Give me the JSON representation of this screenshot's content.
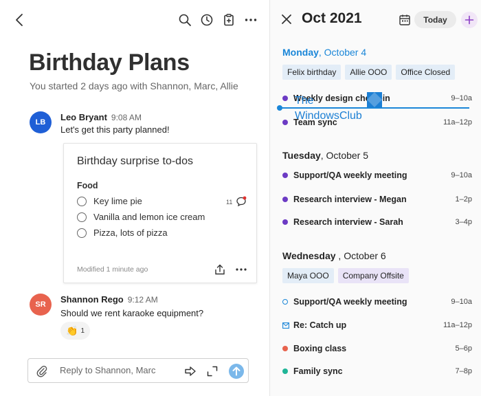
{
  "conversation": {
    "title": "Birthday Plans",
    "subtitle": "You started 2 days ago with Shannon, Marc, Allie",
    "messages": [
      {
        "initials": "LB",
        "name": "Leo Bryant",
        "time": "9:08 AM",
        "text": "Let's get this party planned!",
        "avatar_color": "#1f5fd6"
      },
      {
        "initials": "SR",
        "name": "Shannon Rego",
        "time": "9:12 AM",
        "text": "Should we rent karaoke equipment?",
        "avatar_color": "#e8634e"
      }
    ],
    "card": {
      "title": "Birthday surprise to-dos",
      "section": "Food",
      "todos": [
        "Key lime pie",
        "Vanilla and lemon ice cream",
        "Pizza, lots of pizza"
      ],
      "comment_count": "11",
      "modified": "Modified 1 minute ago"
    },
    "reaction": {
      "emoji": "👏",
      "count": "1"
    },
    "reply_placeholder": "Reply to Shannon, Marc"
  },
  "calendar": {
    "month": "Oct 2021",
    "today_label": "Today",
    "accent": "#1a86d8",
    "days": [
      {
        "name": "Monday",
        "date": ", October 4",
        "chips": [
          "Felix birthday",
          "Allie OOO",
          "Office Closed"
        ],
        "events": [
          {
            "title": "Weekly design check-in",
            "time": "9–10a",
            "color": "#6c3bc4"
          },
          {
            "title": "Team sync",
            "time": "11a–12p",
            "color": "#6c3bc4"
          }
        ]
      },
      {
        "name": "Tuesday",
        "date": ", October 5",
        "chips": [],
        "events": [
          {
            "title": "Support/QA weekly meeting",
            "time": "9–10a",
            "color": "#6c3bc4"
          },
          {
            "title": "Research interview - Megan",
            "time": "1–2p",
            "color": "#6c3bc4"
          },
          {
            "title": "Research interview -  Sarah",
            "time": "3–4p",
            "color": "#6c3bc4"
          }
        ]
      },
      {
        "name": "Wednesday",
        "date": " , October 6",
        "chips": [
          "Maya OOO",
          "Company Offsite"
        ],
        "events": [
          {
            "title": "Support/QA weekly meeting",
            "time": "9–10a",
            "color": "#1a86d8"
          },
          {
            "title": "Re: Catch up",
            "time": "11a–12p",
            "color": "#1a86d8"
          },
          {
            "title": "Boxing class",
            "time": "5–6p",
            "color": "#e8634e"
          },
          {
            "title": "Family sync",
            "time": "7–8p",
            "color": "#1fb597"
          }
        ]
      }
    ]
  },
  "watermark": {
    "line1": "The",
    "line2": "WindowsClub"
  }
}
